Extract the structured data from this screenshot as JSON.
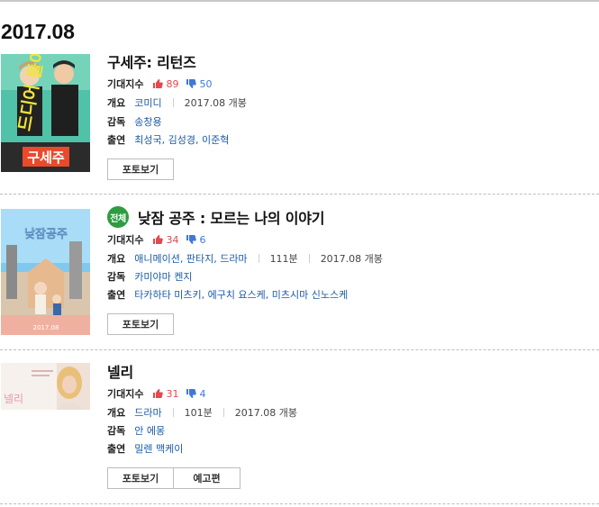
{
  "month_heading": "2017.08",
  "movies": [
    {
      "title": "구세주: 리턴즈",
      "expect_label": "기대지수",
      "likes": "89",
      "dislikes": "50",
      "overview_label": "개요",
      "genres": "코미디",
      "runtime": "",
      "release": "2017.08 개봉",
      "director_label": "감독",
      "director": "송창용",
      "cast_label": "출연",
      "cast": "최성국, 김성경, 이준혁",
      "photo_button": "포토보기",
      "poster_text": "구세주",
      "poster_banner": "드디어 돌아왔나!"
    },
    {
      "title": "낮잠 공주 : 모르는 나의 이야기",
      "rating_badge": "전체",
      "expect_label": "기대지수",
      "likes": "34",
      "dislikes": "6",
      "overview_label": "개요",
      "genres": "애니메이션, 판타지, 드라마",
      "runtime": "111분",
      "release": "2017.08 개봉",
      "director_label": "감독",
      "director": "카미야마 켄지",
      "cast_label": "출연",
      "cast": "타카하타 미츠키, 에구치 요스케, 미츠시마 신노스케",
      "photo_button": "포토보기",
      "poster_text": "낮잠공주",
      "poster_date": "2017.08"
    },
    {
      "title": "넬리",
      "expect_label": "기대지수",
      "likes": "31",
      "dislikes": "4",
      "overview_label": "개요",
      "genres": "드라마",
      "runtime": "101분",
      "release": "2017.08 개봉",
      "director_label": "감독",
      "director": "안 에몽",
      "cast_label": "출연",
      "cast": "밀렌 맥케이",
      "photo_button": "포토보기",
      "trailer_button": "예고편",
      "poster_text": "넬리"
    }
  ],
  "colors": {
    "like": "#e5484d",
    "dislike": "#3f78d8",
    "link": "#1a5aa8",
    "rating_all": "#2f9c3f"
  }
}
